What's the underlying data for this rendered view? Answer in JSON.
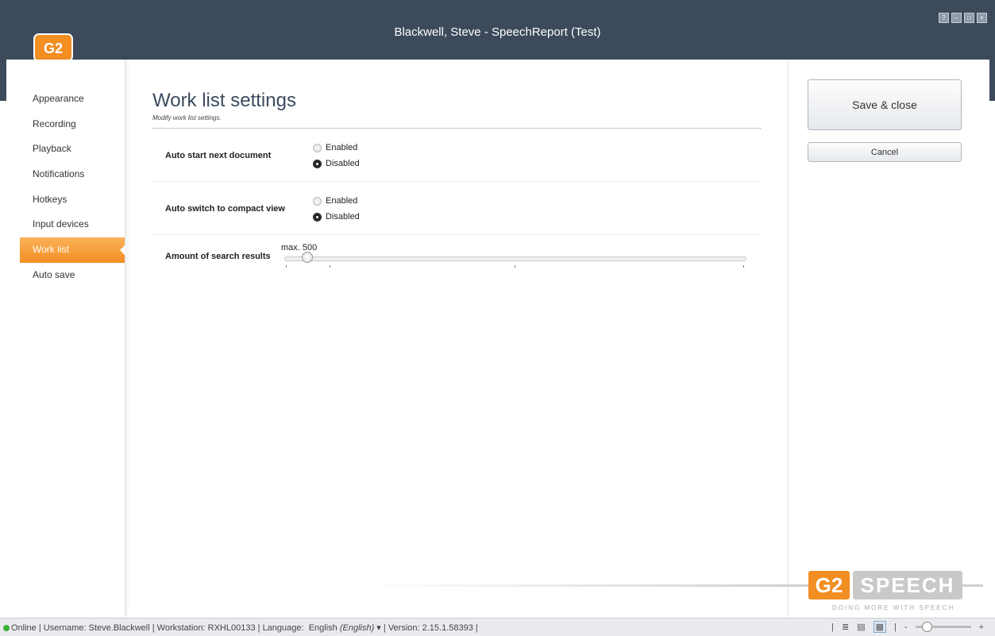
{
  "window": {
    "title": "Blackwell, Steve - SpeechReport (Test)",
    "controls": [
      "?",
      "–",
      "□",
      "×"
    ],
    "logo_text": "G2"
  },
  "sidebar": {
    "items": [
      {
        "label": "Appearance"
      },
      {
        "label": "Recording"
      },
      {
        "label": "Playback"
      },
      {
        "label": "Notifications"
      },
      {
        "label": "Hotkeys"
      },
      {
        "label": "Input devices"
      },
      {
        "label": "Work list"
      },
      {
        "label": "Auto save"
      }
    ],
    "active": "Work list"
  },
  "page": {
    "title": "Work list settings",
    "subtitle": "Modify work list settings."
  },
  "settings": {
    "auto_start": {
      "label": "Auto start next document",
      "options": [
        "Enabled",
        "Disabled"
      ],
      "selected": "Disabled"
    },
    "auto_compact": {
      "label": "Auto switch to compact view",
      "options": [
        "Enabled",
        "Disabled"
      ],
      "selected": "Disabled"
    },
    "search_results": {
      "label": "Amount of search results",
      "value_label": "max. 500"
    }
  },
  "actions": {
    "save_label": "Save & close",
    "cancel_label": "Cancel"
  },
  "brand": {
    "g2": "G2",
    "speech": "SPEECH",
    "tagline": "DOING MORE WITH SPEECH"
  },
  "status": {
    "online": "Online",
    "username": "Username: Steve.Blackwell",
    "workstation": "Workstation: RXHL00133",
    "language_label": "Language:",
    "language_value": "English",
    "language_native": "(English)",
    "version": "Version: 2.15.1.58393",
    "zoom_minus": "-",
    "zoom_plus": "+"
  },
  "colors": {
    "titlebar": "#3c4a5c",
    "accent": "#f28e22",
    "online": "#3bb036"
  }
}
